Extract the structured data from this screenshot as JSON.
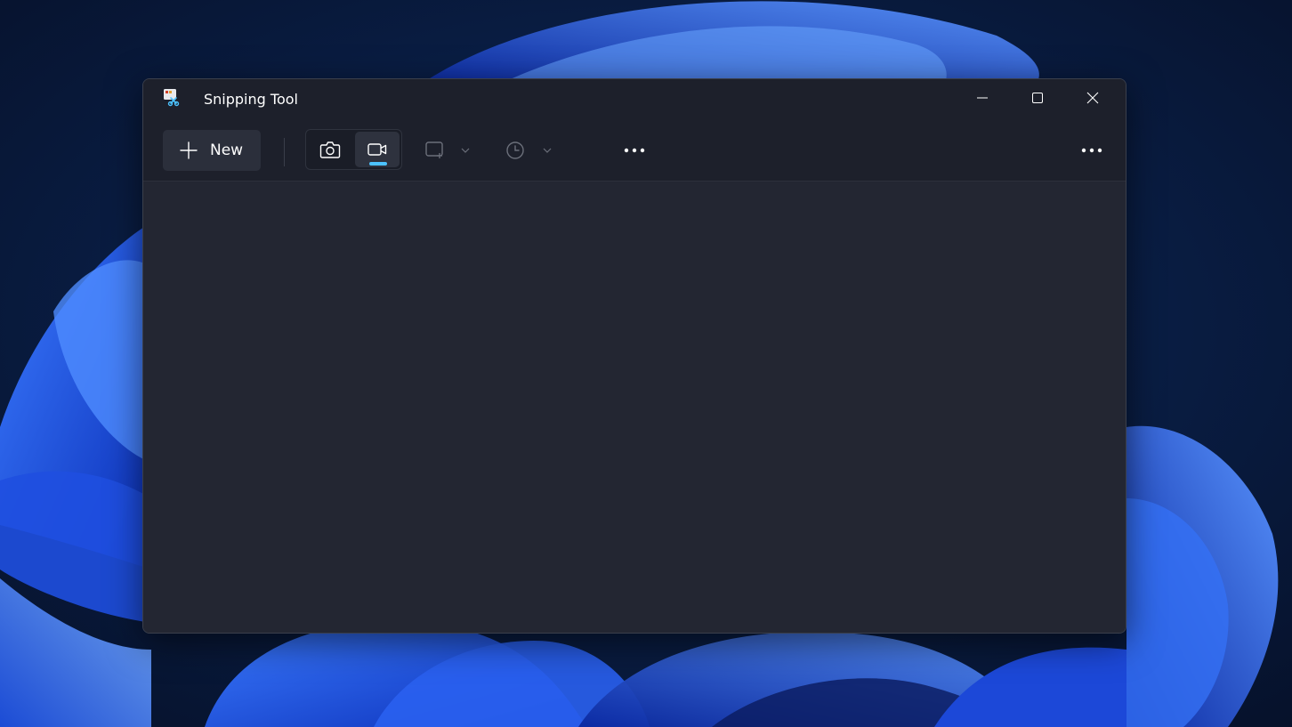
{
  "window": {
    "title": "Snipping Tool",
    "app_icon": "snipping-tool-icon",
    "controls": {
      "minimize_icon": "minimize-icon",
      "maximize_icon": "maximize-icon",
      "close_icon": "close-icon"
    }
  },
  "toolbar": {
    "new_button": {
      "icon": "plus-icon",
      "label": "New"
    },
    "capture_modes": [
      {
        "icon": "camera-icon",
        "selected": false
      },
      {
        "icon": "video-camera-icon",
        "selected": true
      }
    ],
    "snip_mode_dropdown": {
      "icon": "rectangle-snip-icon",
      "chevron": "chevron-down-icon"
    },
    "delay_dropdown": {
      "icon": "clock-icon",
      "chevron": "chevron-down-icon"
    },
    "more_options_icon": "more-icon",
    "see_more_icon": "more-icon"
  },
  "colors": {
    "accent": "#4cc2ff",
    "window_bg": "#212430",
    "titlebar_bg": "#1d202b",
    "text": "#ffffff",
    "disabled": "#6b6f7a"
  }
}
